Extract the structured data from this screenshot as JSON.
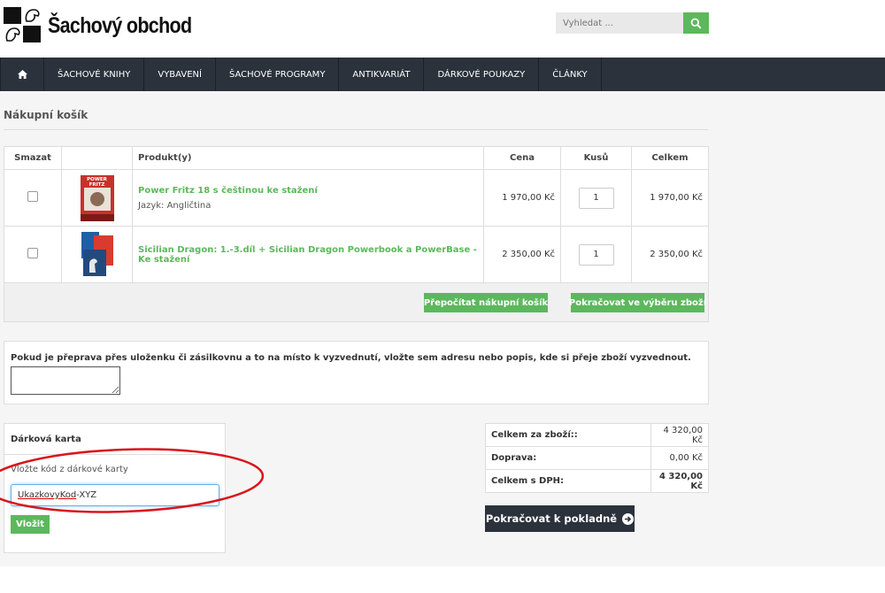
{
  "header": {
    "title": "Šachový obchod",
    "search_placeholder": "Vyhledat ...",
    "icons": {
      "search": "search-icon",
      "home": "home-icon",
      "logo": "knight-logo-icon"
    },
    "accent": "#5cb85c",
    "nav_bg": "#2b323c"
  },
  "nav": {
    "items": [
      "ŠACHOVÉ KNIHY",
      "VYBAVENÍ",
      "ŠACHOVÉ PROGRAMY",
      "ANTIKVARIÁT",
      "DÁRKOVÉ POUKAZY",
      "ČLÁNKY"
    ]
  },
  "page": {
    "title": "Nákupní košík"
  },
  "cart": {
    "columns": {
      "remove": "Smazat",
      "product": "Produkt(y)",
      "price": "Cena",
      "qty": "Kusů",
      "total": "Celkem"
    },
    "rows": [
      {
        "name": "Power Fritz 18 s češtinou ke stažení",
        "variant": "Jazyk: Angličtina",
        "price": "1 970,00 Kč",
        "qty": "1",
        "total": "1 970,00 Kč",
        "thumb_label": "POWER FRITZ"
      },
      {
        "name": "Sicilian Dragon: 1.-3.díl + Sicilian Dragon Powerbook a PowerBase - Ke stažení",
        "variant": "",
        "price": "2 350,00 Kč",
        "qty": "1",
        "total": "2 350,00 Kč",
        "thumb_label": ""
      }
    ],
    "recalc_button": "Přepočítat nákupní košík",
    "continue_button": "Pokračovat ve výběru zboží"
  },
  "note": {
    "label": "Pokud je přeprava přes uloženku či zásilkovnu a to na místo k vyzvednutí, vložte sem adresu nebo popis, kde si přeje zboží vyzvednout.",
    "value": ""
  },
  "gift": {
    "title": "Dárková karta",
    "label": "Vložte kód z dárkové karty",
    "value_underlined": "UkazkovyKod",
    "value_rest": "-XYZ",
    "button": "Vložit"
  },
  "totals": {
    "rows": [
      {
        "label": "Celkem za zboží::",
        "value": "4 320,00 Kč"
      },
      {
        "label": "Doprava:",
        "value": "0,00 Kč"
      },
      {
        "label": "Celkem s DPH:",
        "value": "4 320,00 Kč"
      }
    ],
    "checkout_button": "Pokračovat k pokladně"
  }
}
